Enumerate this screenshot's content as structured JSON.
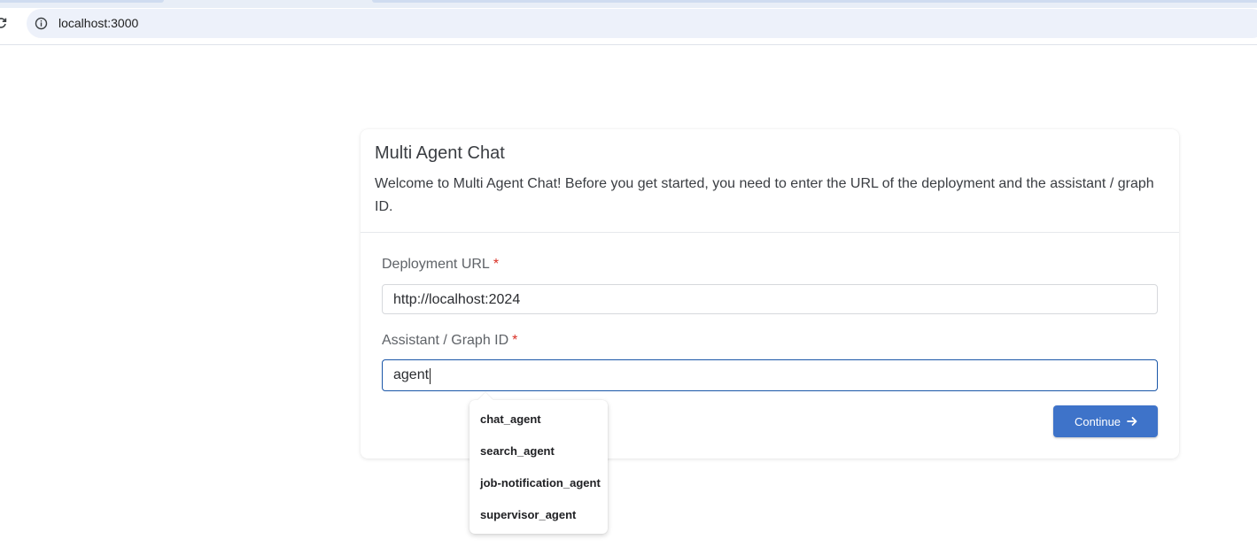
{
  "browser": {
    "url": "localhost:3000"
  },
  "card": {
    "title": "Multi Agent Chat",
    "description": "Welcome to Multi Agent Chat! Before you get started, you need to enter the URL of the deployment and the assistant / graph ID."
  },
  "form": {
    "deployment_url": {
      "label": "Deployment URL",
      "required_mark": "*",
      "value": "http://localhost:2024"
    },
    "assistant_id": {
      "label": "Assistant / Graph ID",
      "required_mark": "*",
      "value": "agent"
    },
    "continue_label": "Continue"
  },
  "suggestions": [
    "chat_agent",
    "search_agent",
    "job-notification_agent",
    "supervisor_agent"
  ],
  "colors": {
    "accent": "#3e73c9",
    "focus_border": "#1a56a8",
    "required": "#d93025"
  }
}
